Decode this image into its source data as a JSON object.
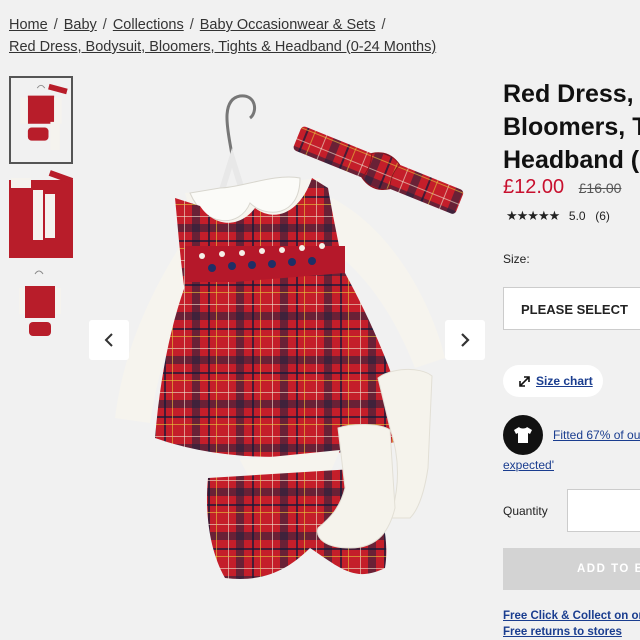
{
  "breadcrumb": {
    "items": [
      "Home",
      "Baby",
      "Collections",
      "Baby Occasionwear & Sets"
    ],
    "separator": "/",
    "current": "Red Dress, Bodysuit, Bloomers, Tights & Headband (0-24 Months)"
  },
  "product": {
    "title_lines": [
      "Red Dress, B",
      "Bloomers, T",
      "Headband ("
    ],
    "price": "£12.00",
    "old_price": "£16.00",
    "stars": "★★★★★",
    "rating_score": "5.0",
    "rating_count": "(6)"
  },
  "size": {
    "label": "Size:",
    "select_placeholder": "PLEASE SELECT",
    "chart_label": "Size chart"
  },
  "fit": {
    "text": "Fitted 67% of ou",
    "text_cont": "expected'"
  },
  "quantity": {
    "label": "Quantity"
  },
  "actions": {
    "add_to_bag": "ADD TO BA",
    "click_collect": "Free Click & Collect on ord",
    "returns": "Free returns to stores"
  },
  "colors": {
    "price_red": "#c8102e",
    "link_blue": "#1a3d8f",
    "tartan_red": "#c41e2a"
  },
  "icons": {
    "prev": "chevron-left-icon",
    "next": "chevron-right-icon",
    "size_chart": "resize-arrow-icon",
    "fit": "shirt-icon"
  }
}
